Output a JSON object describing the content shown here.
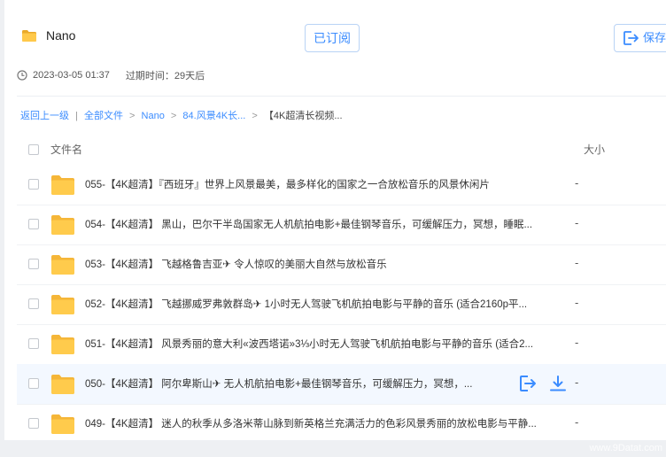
{
  "share": {
    "title": "Nano",
    "subscribe_label": "已订阅",
    "save_label": "保存",
    "date": "2023-03-05 01:37",
    "expire": "过期时间：29天后"
  },
  "breadcrumb": {
    "back": "返回上一级",
    "sep1": "|",
    "all": "全部文件",
    "item1": "Nano",
    "item2": "84.风景4K长...",
    "current": "【4K超清长视频...",
    "arrow": ">"
  },
  "table": {
    "col_name": "文件名",
    "col_size": "大小",
    "rows": [
      {
        "name": "055-【4K超清】『西班牙』世界上风景最美，最多样化的国家之一合放松音乐的风景休闲片",
        "size": "-"
      },
      {
        "name": "054-【4K超清】 黑山，巴尔干半岛国家无人机航拍电影+最佳钢琴音乐，可缓解压力，冥想，睡眠...",
        "size": "-"
      },
      {
        "name": "053-【4K超清】 飞越格鲁吉亚✈ 令人惊叹的美丽大自然与放松音乐",
        "size": "-"
      },
      {
        "name": "052-【4K超清】 飞越挪威罗弗敦群岛✈ 1小时无人驾驶飞机航拍电影与平静的音乐 (适合2160p平...",
        "size": "-"
      },
      {
        "name": "051-【4K超清】 风景秀丽的意大利«波西塔诺»3⅓小时无人驾驶飞机航拍电影与平静的音乐 (适合2...",
        "size": "-"
      },
      {
        "name": "050-【4K超清】 阿尔卑斯山✈ 无人机航拍电影+最佳钢琴音乐，可缓解压力，冥想，...",
        "size": "-"
      },
      {
        "name": "049-【4K超清】 迷人的秋季从多洛米蒂山脉到新英格兰充满活力的色彩风景秀丽的放松电影与平静...",
        "size": "-"
      }
    ]
  },
  "watermark": "www.9Datat.com",
  "colors": {
    "accent": "#3b8cff",
    "folder": "#ffc94a",
    "hover_row": "#f3f8ff"
  },
  "icons": {
    "folder": "folder-icon",
    "clock": "clock-icon",
    "save": "save-icon",
    "download": "download-icon"
  }
}
